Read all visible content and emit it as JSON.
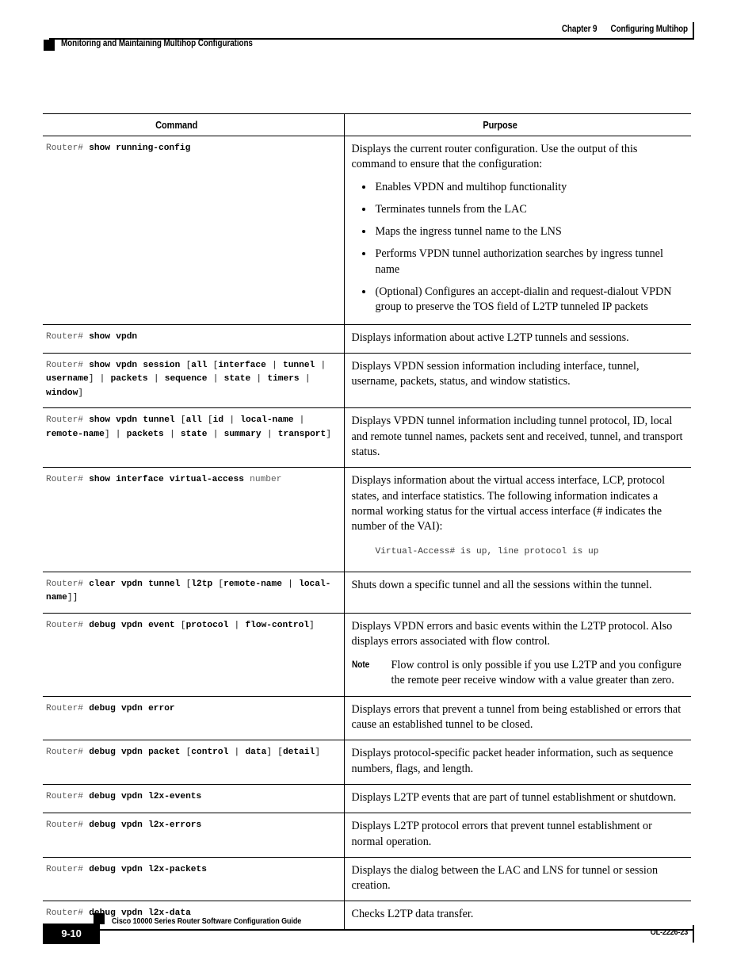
{
  "header": {
    "chapter_number": "Chapter 9",
    "chapter_title": "Configuring Multihop",
    "section_title": "Monitoring and Maintaining Multihop Configurations"
  },
  "footer": {
    "guide_title": "Cisco 10000 Series Router Software Configuration Guide",
    "page_number": "9-10",
    "document_id": "OL-2226-23"
  },
  "table": {
    "columns": {
      "command": "Command",
      "purpose": "Purpose"
    },
    "rows": [
      {
        "command": {
          "prompt": "Router#",
          "keyword": "show running-config",
          "tail": ""
        },
        "purpose": {
          "paragraphs": [
            "Displays the current router configuration. Use the output of this command to ensure that the configuration:"
          ],
          "bullets": [
            "Enables VPDN and multihop functionality",
            "Terminates tunnels from the LAC",
            "Maps the ingress tunnel name to the LNS",
            "Performs VPDN tunnel authorization searches by ingress tunnel name",
            "(Optional) Configures an accept-dialin and request-dialout VPDN group to preserve the TOS field of L2TP tunneled IP packets"
          ]
        }
      },
      {
        "command": {
          "prompt": "Router#",
          "keyword": "show vpdn",
          "tail": ""
        },
        "purpose": {
          "paragraphs": [
            "Displays information about active L2TP tunnels and sessions."
          ]
        }
      },
      {
        "command": {
          "prompt": "Router#",
          "keyword": "show vpdn session",
          "tail": " [all [interface | tunnel | username] | packets | sequence | state | timers | window]"
        },
        "purpose": {
          "paragraphs": [
            "Displays VPDN session information including interface, tunnel, username, packets, status, and window statistics."
          ]
        }
      },
      {
        "command": {
          "prompt": "Router#",
          "keyword": "show vpdn tunnel",
          "tail": " [all [id | local-name | remote-name] | packets | state | summary | transport]"
        },
        "purpose": {
          "paragraphs": [
            "Displays VPDN tunnel information including tunnel protocol, ID, local and remote tunnel names, packets sent and received, tunnel, and transport status."
          ]
        }
      },
      {
        "command": {
          "prompt": "Router#",
          "keyword": "show interface virtual-access",
          "tail": " number"
        },
        "purpose": {
          "paragraphs": [
            "Displays information about the virtual access interface, LCP, protocol states, and interface statistics. The following information indicates a normal working status for the virtual access interface (# indicates the number of the VAI):"
          ],
          "code_sample": "Virtual-Access# is up, line protocol is up"
        }
      },
      {
        "command": {
          "prompt": "Router#",
          "keyword": "clear vpdn tunnel",
          "tail": " [l2tp [remote-name | local-name]]"
        },
        "purpose": {
          "paragraphs": [
            "Shuts down a specific tunnel and all the sessions within the tunnel."
          ]
        }
      },
      {
        "command": {
          "prompt": "Router#",
          "keyword": "debug vpdn event",
          "tail": " [protocol | flow-control]"
        },
        "purpose": {
          "paragraphs": [
            "Displays VPDN errors and basic events within the L2TP protocol. Also displays errors associated with flow control."
          ],
          "note": {
            "label": "Note",
            "text": "Flow control is only possible if you use L2TP and you configure the remote peer receive window with a value greater than zero."
          }
        }
      },
      {
        "command": {
          "prompt": "Router#",
          "keyword": "debug vpdn error",
          "tail": ""
        },
        "purpose": {
          "paragraphs": [
            "Displays errors that prevent a tunnel from being established or errors that cause an established tunnel to be closed."
          ]
        }
      },
      {
        "command": {
          "prompt": "Router#",
          "keyword": "debug vpdn packet",
          "tail": " [control | data] [detail]"
        },
        "purpose": {
          "paragraphs": [
            "Displays protocol-specific packet header information, such as sequence numbers, flags, and length."
          ]
        }
      },
      {
        "command": {
          "prompt": "Router#",
          "keyword": "debug vpdn l2x-events",
          "tail": ""
        },
        "purpose": {
          "paragraphs": [
            "Displays L2TP events that are part of tunnel establishment or shutdown."
          ]
        }
      },
      {
        "command": {
          "prompt": "Router#",
          "keyword": "debug vpdn l2x-errors",
          "tail": ""
        },
        "purpose": {
          "paragraphs": [
            "Displays L2TP protocol errors that prevent tunnel establishment or normal operation."
          ]
        }
      },
      {
        "command": {
          "prompt": "Router#",
          "keyword": "debug vpdn l2x-packets",
          "tail": ""
        },
        "purpose": {
          "paragraphs": [
            "Displays the dialog between the LAC and LNS for tunnel or session creation."
          ]
        }
      },
      {
        "command": {
          "prompt": "Router#",
          "keyword": "debug vpdn l2x-data",
          "tail": ""
        },
        "purpose": {
          "paragraphs": [
            "Checks L2TP data transfer."
          ]
        }
      }
    ]
  }
}
